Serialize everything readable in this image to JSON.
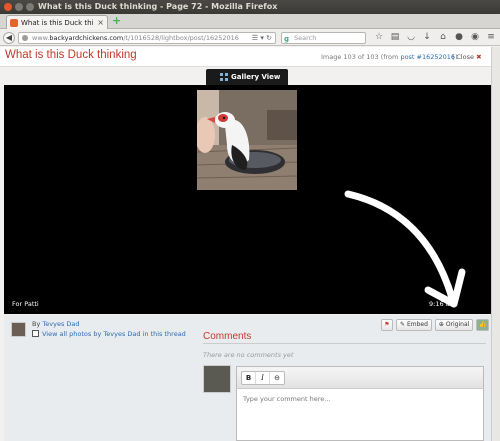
{
  "window": {
    "title": "What is this Duck thinking - Page 72 - Mozilla Firefox"
  },
  "tab": {
    "label": "What is this Duck thi...",
    "close": "×",
    "new_tab": "+"
  },
  "navbar": {
    "url_prefix": "www.",
    "url_host": "backyardchickens.com",
    "url_path": "/t/1016528/lightbox/post/16252016",
    "search_placeholder": "Search"
  },
  "header": {
    "title": "What is this Duck thinking",
    "image_count_prefix": "Image 103 of 103 (from ",
    "image_count_link": "post #16252016",
    "image_count_suffix": ")",
    "close_label": "Close"
  },
  "viewer": {
    "gallery_label": "Gallery View",
    "caption": "For Patti",
    "timestamp": "9:16 am"
  },
  "author": {
    "by_label": "By",
    "name": "Tevyes Dad",
    "view_all": "View all photos by Tevyes Dad in this thread"
  },
  "actions": {
    "embed_label": "Embed",
    "original_label": "Original"
  },
  "comments": {
    "title": "Comments",
    "empty_text": "There are no comments yet",
    "placeholder": "Type your comment here...",
    "bold": "B",
    "italic": "I",
    "link": "⊖"
  }
}
